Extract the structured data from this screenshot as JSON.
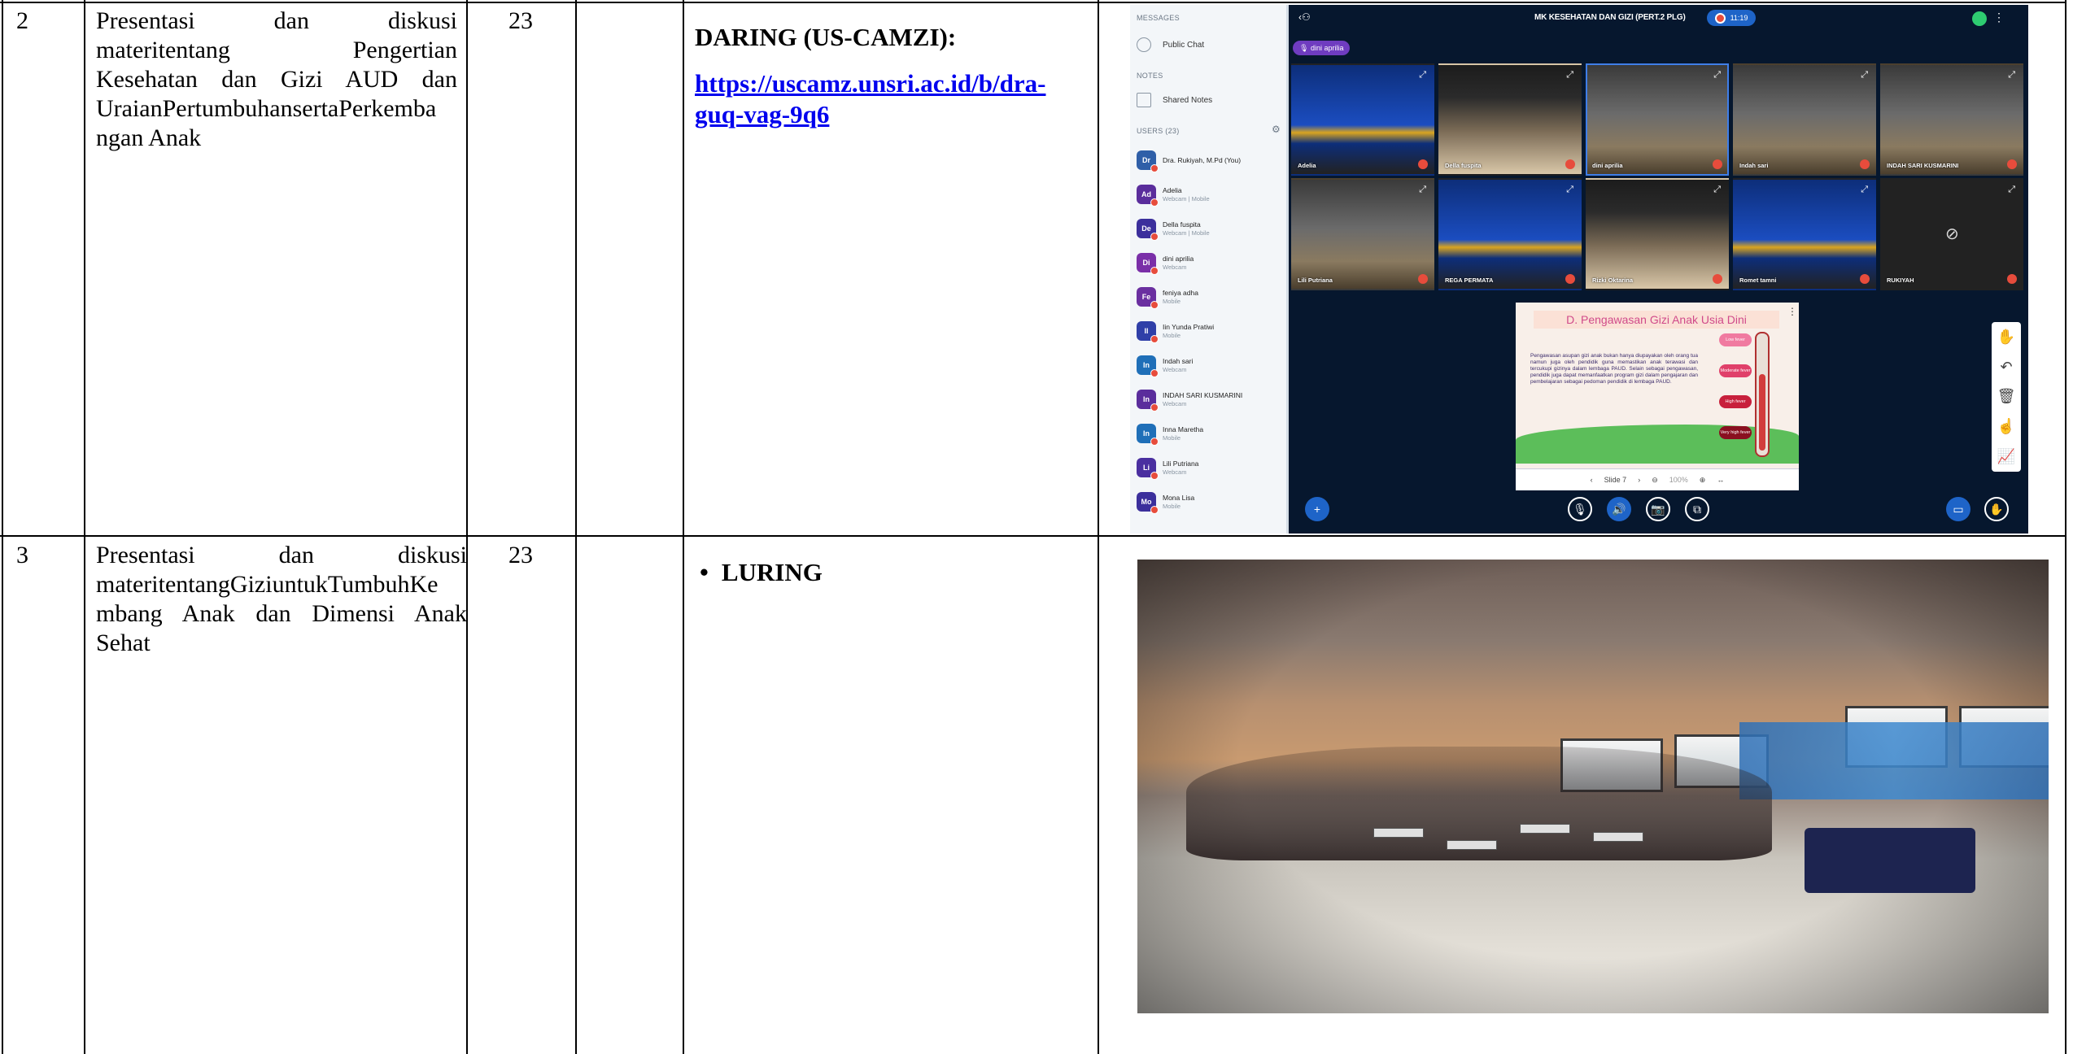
{
  "rows": [
    {
      "no": "2",
      "topic_lines": [
        "Presentasi dan diskusi",
        "materitentang Pengertian",
        "Kesehatan dan Gizi AUD dan",
        "UraianPertumbuhansertaPerkemba",
        "ngan Anak"
      ],
      "count": "23",
      "mode_heading": "DARING (US-CAMZI):",
      "link_lines": [
        "https://uscamz.unsri.ac.id/b/dra-",
        "guq-vag-9q6"
      ]
    },
    {
      "no": "3",
      "topic_lines": [
        "Presentasi dan diskusi",
        "materitentangGiziuntukTumbuhKe",
        "mbang Anak dan Dimensi Anak",
        "Sehat"
      ],
      "count": "23",
      "mode_heading": "LURING"
    }
  ],
  "bbb": {
    "messages_label": "MESSAGES",
    "public_chat": "Public Chat",
    "notes_label": "NOTES",
    "shared_notes": "Shared Notes",
    "users_label": "USERS (23)",
    "users": [
      {
        "initials": "Dr",
        "name": "Dra. Rukiyah, M.Pd (You)",
        "status": "",
        "color": "#2f5fa8"
      },
      {
        "initials": "Ad",
        "name": "Adelia",
        "status": "Webcam | Mobile",
        "color": "#5a2d9c"
      },
      {
        "initials": "De",
        "name": "Della fuspita",
        "status": "Webcam | Mobile",
        "color": "#3b2f9c"
      },
      {
        "initials": "Di",
        "name": "dini aprilia",
        "status": "Webcam",
        "color": "#7a2fa8"
      },
      {
        "initials": "Fe",
        "name": "feniya adha",
        "status": "Mobile",
        "color": "#6a2fa0"
      },
      {
        "initials": "Il",
        "name": "Iin Yunda Pratiwi",
        "status": "Mobile",
        "color": "#2f3fa8"
      },
      {
        "initials": "In",
        "name": "Indah sari",
        "status": "Webcam",
        "color": "#1f6fb8"
      },
      {
        "initials": "In",
        "name": "INDAH SARI KUSMARINI",
        "status": "Webcam",
        "color": "#5a2d9c"
      },
      {
        "initials": "In",
        "name": "Inna Maretha",
        "status": "Mobile",
        "color": "#1f6fb8"
      },
      {
        "initials": "Li",
        "name": "Lili Putriana",
        "status": "Webcam",
        "color": "#4a2fa0"
      },
      {
        "initials": "Mo",
        "name": "Mona Lisa",
        "status": "Mobile",
        "color": "#3b2f9c"
      }
    ],
    "meeting_title": "MK KESEHATAN DAN GIZI (PERT.2 PLG)",
    "recording_time": "11:19",
    "presenter_pill": "dini aprilia",
    "videos": [
      {
        "name": "Adelia",
        "bg": "bg-blue",
        "active": false
      },
      {
        "name": "Della fuspita",
        "bg": "bg-room",
        "active": false
      },
      {
        "name": "dini aprilia",
        "bg": "bg-class",
        "active": true
      },
      {
        "name": "Indah sari",
        "bg": "bg-class",
        "active": false
      },
      {
        "name": "INDAH SARI KUSMARINI",
        "bg": "bg-class",
        "active": false
      },
      {
        "name": "Lili Putriana",
        "bg": "bg-class",
        "active": false
      },
      {
        "name": "REGA PERMATA",
        "bg": "bg-blue",
        "active": false
      },
      {
        "name": "Rizki Oktarina",
        "bg": "bg-room",
        "active": false
      },
      {
        "name": "Romet tamni",
        "bg": "bg-blue",
        "active": false
      },
      {
        "name": "RUKIYAH",
        "bg": "bg-dark",
        "active": false
      }
    ],
    "slide_title": "D. Pengawasan Gizi Anak Usia Dini",
    "slide_body": "Pengawasan asupan gizi anak bukan hanya diupayakan oleh orang tua namun juga oleh pendidik guna memastikan anak terawasi dan tercukupi gizinya dalam lembaga PAUD. Selain sebagai pengawasan, pendidik juga dapat memanfaatkan program gizi dalam pengajaran dan pembelajaran sebagai pedoman pendidik di lembaga PAUD.",
    "slide_tags": [
      {
        "label": "Low fever",
        "color": "#f07aa0"
      },
      {
        "label": "Moderate fever",
        "color": "#e0406a"
      },
      {
        "label": "High fever",
        "color": "#c8203c"
      },
      {
        "label": "Very high fever",
        "color": "#8a1020"
      }
    ],
    "slide_nav": "Slide 7",
    "zoom": "100%"
  }
}
